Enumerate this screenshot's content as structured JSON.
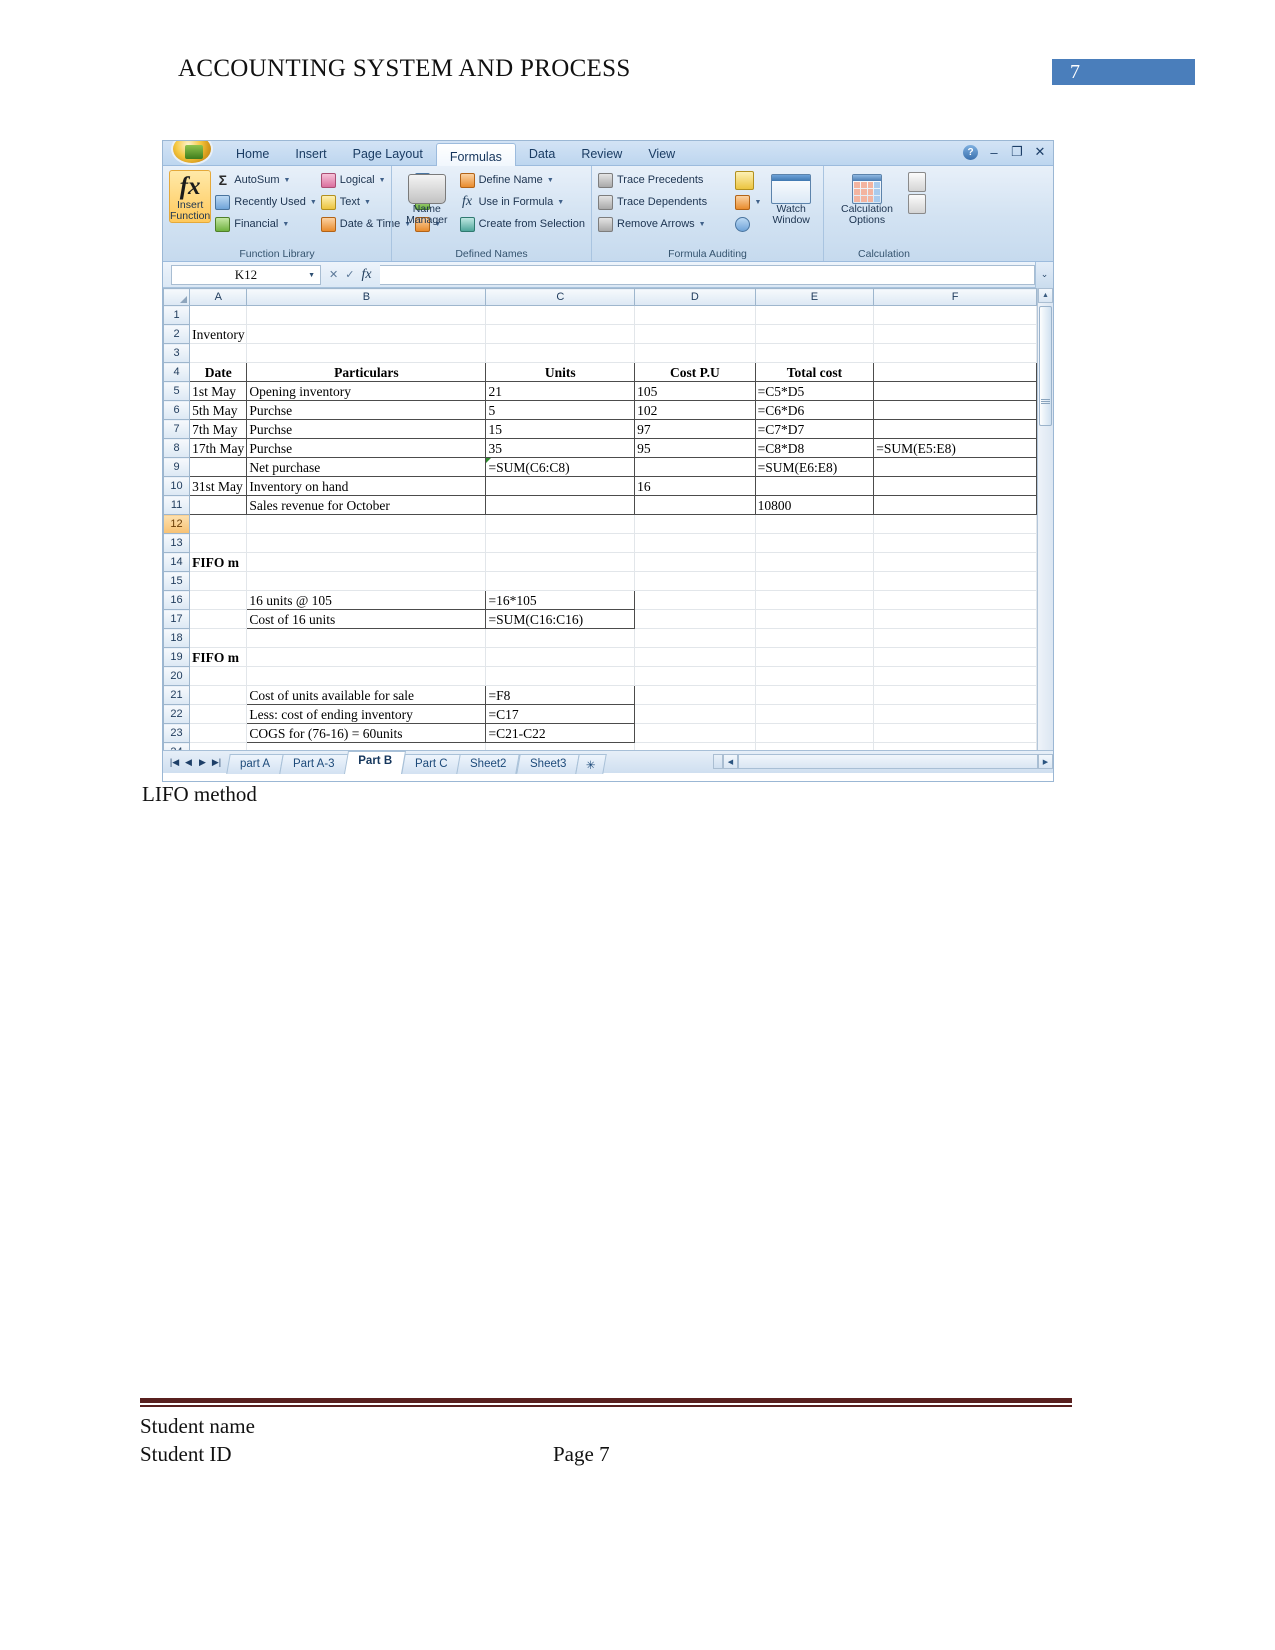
{
  "document": {
    "header_title": "ACCOUNTING SYSTEM AND PROCESS",
    "page_badge": "7",
    "badge_color": "#4a7ebb",
    "caption_below_image": "LIFO method",
    "footer": {
      "student_name": "Student name",
      "student_id": "Student ID",
      "page_label": "Page 7",
      "rule_color": "#58201f"
    }
  },
  "excel": {
    "ribbon": {
      "office_button": "office-orb",
      "tabs": [
        {
          "label": "Home",
          "active": false
        },
        {
          "label": "Insert",
          "active": false
        },
        {
          "label": "Page Layout",
          "active": false
        },
        {
          "label": "Formulas",
          "active": true
        },
        {
          "label": "Data",
          "active": false
        },
        {
          "label": "Review",
          "active": false
        },
        {
          "label": "View",
          "active": false
        }
      ],
      "window_controls": {
        "help": "?",
        "minimize": "–",
        "restore": "❐",
        "close": "✕"
      },
      "groups": [
        {
          "label": "Function Library",
          "big_button": {
            "label_line1": "Insert",
            "label_line2": "Function",
            "glyph": "fx"
          },
          "items": [
            "AutoSum",
            "Recently Used",
            "Financial",
            "Logical",
            "Text",
            "Date & Time"
          ]
        },
        {
          "label": "Defined Names",
          "big_button": {
            "label_line1": "Name",
            "label_line2": "Manager",
            "glyph": "name-manager-icon"
          },
          "items": [
            "Define Name",
            "Use in Formula",
            "Create from Selection"
          ]
        },
        {
          "label": "Formula Auditing",
          "items": [
            "Trace Precedents",
            "Trace Dependents",
            "Remove Arrows"
          ],
          "big_button": {
            "label_line1": "Watch",
            "label_line2": "Window",
            "glyph": "watch-window-icon"
          }
        },
        {
          "label": "Calculation",
          "big_button": {
            "label_line1": "Calculation",
            "label_line2": "Options",
            "glyph": "calculation-options-icon"
          }
        }
      ]
    },
    "formula_bar": {
      "name_box": "K12",
      "formula_value": "",
      "fx_label": "fx"
    },
    "grid": {
      "columns": [
        "A",
        "B",
        "C",
        "D",
        "E",
        "F"
      ],
      "selected_row": "12",
      "rows": [
        {
          "n": "1",
          "a": "",
          "b": "",
          "c": "",
          "d": "",
          "e": "",
          "f": ""
        },
        {
          "n": "2",
          "a": "Inventory",
          "b": "",
          "c": "",
          "d": "",
          "e": "",
          "f": ""
        },
        {
          "n": "3",
          "a": "",
          "b": "",
          "c": "",
          "d": "",
          "e": "",
          "f": ""
        },
        {
          "n": "4",
          "a": "Date",
          "b": "Particulars",
          "c": "Units",
          "d": "Cost P.U",
          "e": "Total cost",
          "f": ""
        },
        {
          "n": "5",
          "a": "1st May",
          "b": "Opening inventory",
          "c": "21",
          "d": "105",
          "e": "=C5*D5",
          "f": ""
        },
        {
          "n": "6",
          "a": "5th May",
          "b": "Purchse",
          "c": "5",
          "d": "102",
          "e": "=C6*D6",
          "f": ""
        },
        {
          "n": "7",
          "a": "7th May",
          "b": "Purchse",
          "c": "15",
          "d": "97",
          "e": "=C7*D7",
          "f": ""
        },
        {
          "n": "8",
          "a": "17th May",
          "b": "Purchse",
          "c": "35",
          "d": "95",
          "e": "=C8*D8",
          "f": "=SUM(E5:E8)"
        },
        {
          "n": "9",
          "a": "",
          "b": "Net purchase",
          "c": "=SUM(C6:C8)",
          "d": "",
          "e": "=SUM(E6:E8)",
          "f": ""
        },
        {
          "n": "10",
          "a": "31st May",
          "b": "Inventory on hand",
          "c": "",
          "d": "16",
          "e": "",
          "f": ""
        },
        {
          "n": "11",
          "a": "",
          "b": "Sales revenue for October",
          "c": "",
          "d": "",
          "e": "10800",
          "f": ""
        },
        {
          "n": "12",
          "a": "",
          "b": "",
          "c": "",
          "d": "",
          "e": "",
          "f": ""
        },
        {
          "n": "13",
          "a": "",
          "b": "",
          "c": "",
          "d": "",
          "e": "",
          "f": ""
        },
        {
          "n": "14",
          "a": "FIFO m",
          "b": "",
          "c": "",
          "d": "",
          "e": "",
          "f": ""
        },
        {
          "n": "15",
          "a": "",
          "b": "",
          "c": "",
          "d": "",
          "e": "",
          "f": ""
        },
        {
          "n": "16",
          "a": "",
          "b": "16 units @ 105",
          "c": "=16*105",
          "d": "",
          "e": "",
          "f": ""
        },
        {
          "n": "17",
          "a": "",
          "b": "Cost of 16 units",
          "c": "=SUM(C16:C16)",
          "d": "",
          "e": "",
          "f": ""
        },
        {
          "n": "18",
          "a": "",
          "b": "",
          "c": "",
          "d": "",
          "e": "",
          "f": ""
        },
        {
          "n": "19",
          "a": "FIFO m",
          "b": "",
          "c": "",
          "d": "",
          "e": "",
          "f": ""
        },
        {
          "n": "20",
          "a": "",
          "b": "",
          "c": "",
          "d": "",
          "e": "",
          "f": ""
        },
        {
          "n": "21",
          "a": "",
          "b": "Cost of units available for sale",
          "c": "=F8",
          "d": "",
          "e": "",
          "f": ""
        },
        {
          "n": "22",
          "a": "",
          "b": "Less: cost of ending inventory",
          "c": "=C17",
          "d": "",
          "e": "",
          "f": ""
        },
        {
          "n": "23",
          "a": "",
          "b": "COGS for  (76-16) = 60units",
          "c": "=C21-C22",
          "d": "",
          "e": "",
          "f": ""
        },
        {
          "n": "24",
          "a": "",
          "b": "",
          "c": "",
          "d": "",
          "e": "",
          "f": ""
        }
      ]
    },
    "sheet_tabs": [
      {
        "label": "part A",
        "active": false
      },
      {
        "label": "Part A-3",
        "active": false
      },
      {
        "label": "Part B",
        "active": true
      },
      {
        "label": "Part C",
        "active": false
      },
      {
        "label": "Sheet2",
        "active": false
      },
      {
        "label": "Sheet3",
        "active": false
      }
    ]
  }
}
